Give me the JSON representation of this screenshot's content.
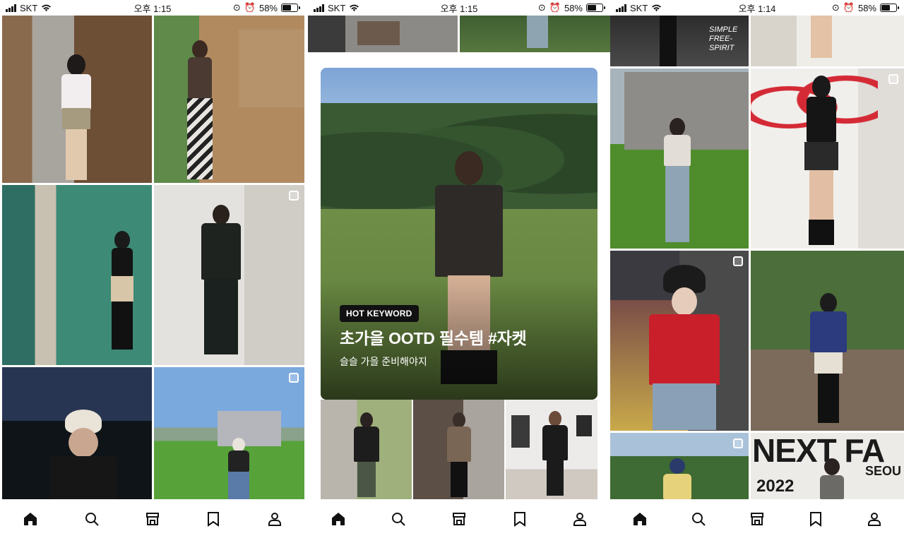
{
  "screens": [
    {
      "status": {
        "carrier": "SKT",
        "time": "오후 1:15",
        "battery": "58%",
        "battery_level": 0.58
      }
    },
    {
      "status": {
        "carrier": "SKT",
        "time": "오후 1:15",
        "battery": "58%",
        "battery_level": 0.58
      },
      "banner": {
        "badge": "HOT KEYWORD",
        "title": "초가을 OOTD 필수템 #자켓",
        "subtitle": "슬슬 가을 준비해야지"
      }
    },
    {
      "status": {
        "carrier": "SKT",
        "time": "오후 1:14",
        "battery": "58%",
        "battery_level": 0.58
      },
      "signs": {
        "neon_tile": "NEXT FA",
        "neon_sub": "SEOU",
        "year": "2022",
        "graffiti": "SIMPLE FREE-SPIRIT"
      }
    }
  ],
  "tabbar": {
    "items": [
      {
        "icon": "home-icon",
        "active": true
      },
      {
        "icon": "search-icon",
        "active": false
      },
      {
        "icon": "store-icon",
        "active": false
      },
      {
        "icon": "bookmark-icon",
        "active": false
      },
      {
        "icon": "profile-icon",
        "active": false
      }
    ]
  },
  "colors": {
    "text": "#111111",
    "badge_bg": "#111111",
    "background": "#ffffff"
  }
}
